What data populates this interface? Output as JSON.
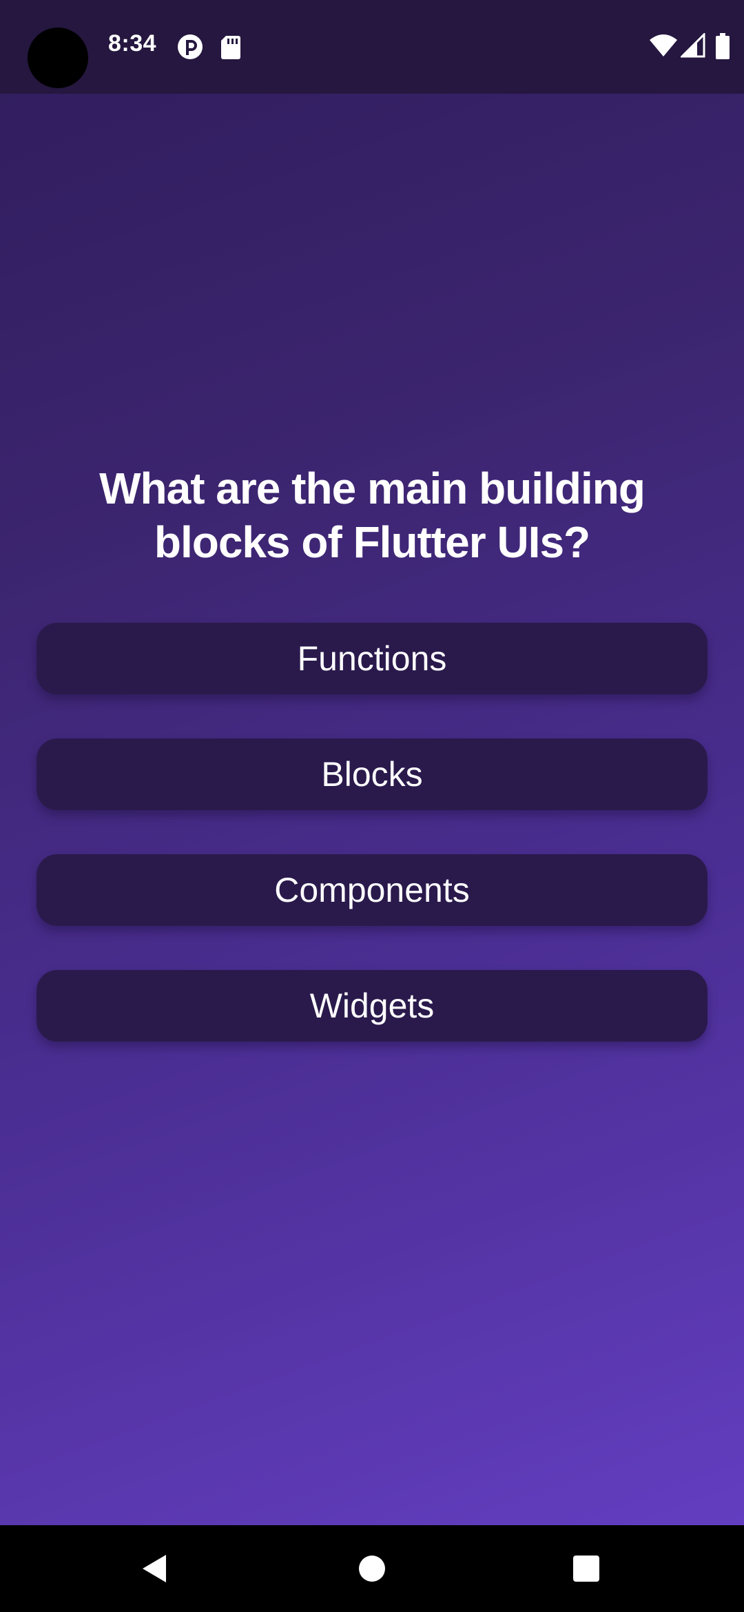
{
  "status_bar": {
    "time": "8:34",
    "icons": [
      "pocket-casts-icon",
      "sd-card-icon",
      "wifi-icon",
      "signal-icon",
      "battery-icon"
    ]
  },
  "quiz": {
    "question": "What are the main building blocks of Flutter UIs?",
    "answers": [
      {
        "label": "Functions"
      },
      {
        "label": "Blocks"
      },
      {
        "label": "Components"
      },
      {
        "label": "Widgets"
      }
    ]
  },
  "nav_bar": {
    "icons": [
      "back-icon",
      "home-icon",
      "recents-icon"
    ]
  },
  "colors": {
    "gradient_top": "#2f1c5c",
    "gradient_bottom": "#6640c6",
    "answer_button": "#2a1a4c",
    "status_bar": "#25173f",
    "text": "#ffffff"
  }
}
